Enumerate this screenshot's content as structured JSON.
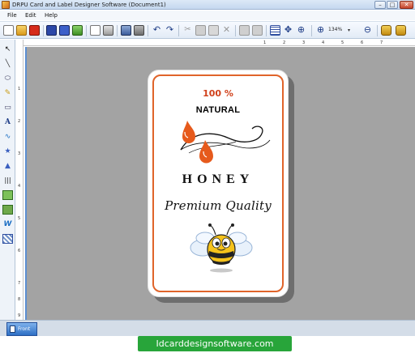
{
  "window": {
    "title": "DRPU Card and Label Designer Software  (Document1)",
    "minimize": "–",
    "maximize": "□",
    "close": "✕"
  },
  "menu": [
    "File",
    "Edit",
    "Help"
  ],
  "toolbar": {
    "zoom_level": "134%",
    "zoom_dropdown": "▾"
  },
  "ruler": {
    "h_numbers": [
      "1",
      "2",
      "3",
      "4",
      "5",
      "6",
      "7"
    ],
    "v_numbers": [
      "1",
      "2",
      "3",
      "4",
      "5",
      "6",
      "7",
      "8",
      "9"
    ]
  },
  "label": {
    "percent": "100 %",
    "natural": "NATURAL",
    "honey": "HONEY",
    "tagline": "Premium Quality"
  },
  "tabs": {
    "front": "Front"
  },
  "watermark": "Idcarddesignsoftware.com",
  "colors": {
    "accent_orange": "#e0642a",
    "canvas_gray": "#a3a3a3",
    "watermark_green": "#28a53a",
    "selection_blue": "#5c8fd1"
  }
}
